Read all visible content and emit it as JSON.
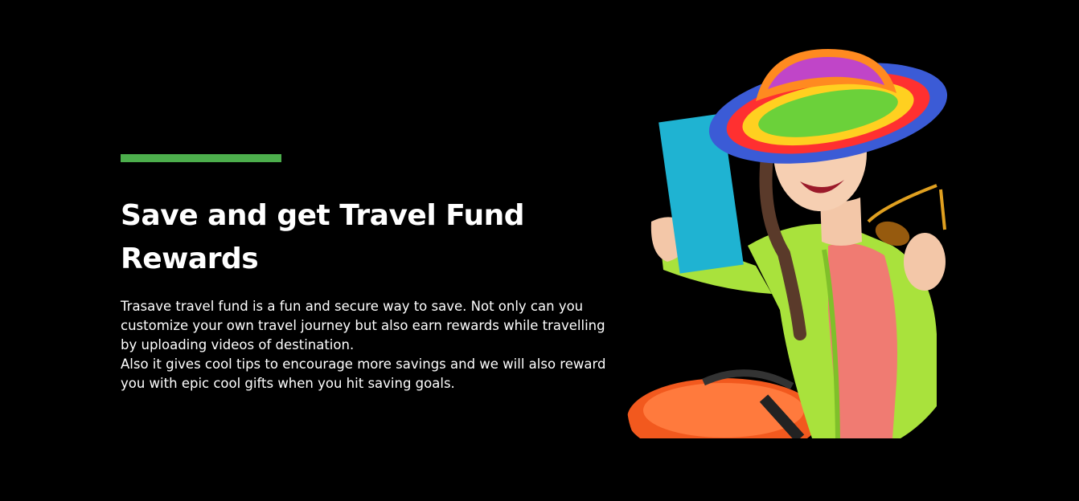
{
  "section": {
    "heading": "Save and get Travel Fund Rewards",
    "paragraph_1": "Trasave travel fund is a fun and secure way to save. Not only can you customize your own travel journey but also earn rewards while travelling by uploading videos of destination.",
    "paragraph_2": "Also it gives cool tips to encourage more savings and we will also reward you with epic cool gifts when you hit saving goals.",
    "accent_color": "#4cae4c",
    "background_color": "#000000"
  },
  "hero_image": {
    "icon": "traveler-woman-illustration"
  }
}
